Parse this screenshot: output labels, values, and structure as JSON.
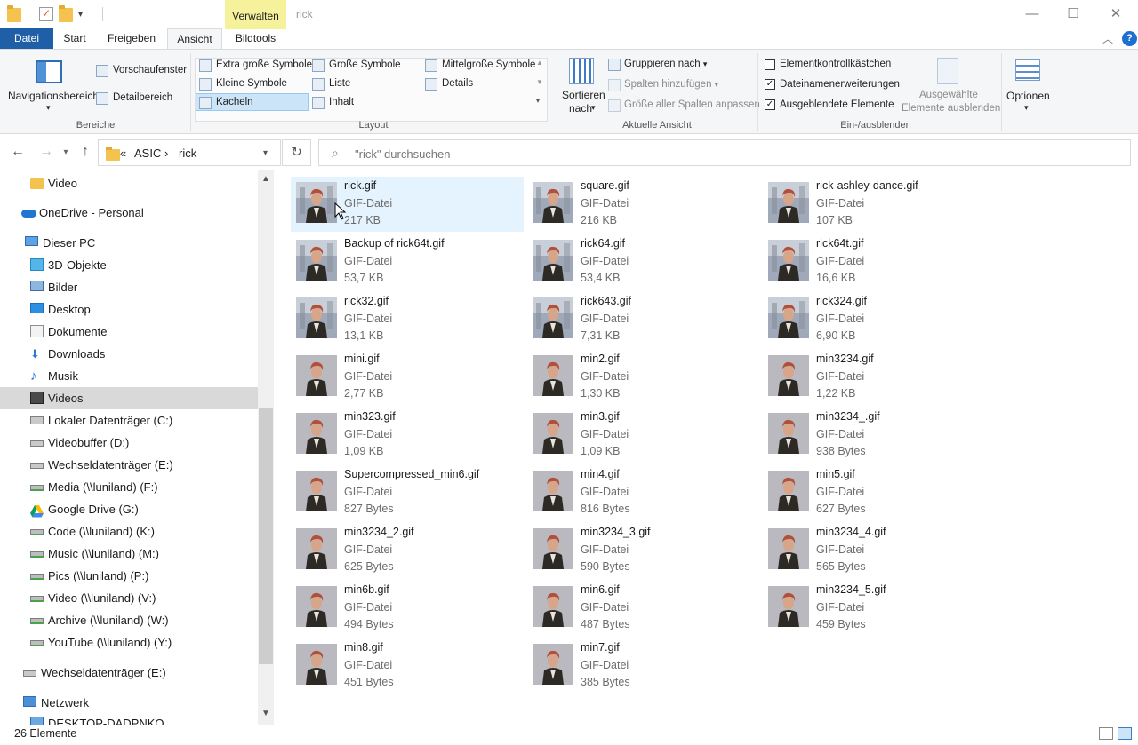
{
  "window": {
    "title": "rick",
    "contextual_tab": "Verwalten",
    "controls": {
      "minimize": "—",
      "maximize": "☐",
      "close": "✕"
    }
  },
  "tabs": {
    "file": "Datei",
    "start": "Start",
    "share": "Freigeben",
    "view": "Ansicht",
    "picture_tools": "Bildtools"
  },
  "ribbon": {
    "panes": {
      "navigation_pane": "Navigationsbereich",
      "preview_pane": "Vorschaufenster",
      "details_pane": "Detailbereich",
      "group_label": "Bereiche"
    },
    "layout": {
      "extra_large": "Extra große Symbole",
      "large": "Große Symbole",
      "medium": "Mittelgroße Symbole",
      "small": "Kleine Symbole",
      "list": "Liste",
      "details": "Details",
      "tiles": "Kacheln",
      "content": "Inhalt",
      "group_label": "Layout",
      "selected": "Kacheln"
    },
    "current_view": {
      "sort_by_line1": "Sortieren",
      "sort_by_line2": "nach",
      "group_by": "Gruppieren nach",
      "add_columns": "Spalten hinzufügen",
      "size_columns": "Größe aller Spalten anpassen",
      "group_label": "Aktuelle Ansicht"
    },
    "show_hide": {
      "item_checkboxes": "Elementkontrollkästchen",
      "item_checkboxes_checked": false,
      "file_extensions": "Dateinamenerweiterungen",
      "file_extensions_checked": true,
      "hidden_items": "Ausgeblendete Elemente",
      "hidden_items_checked": true,
      "hide_selected_line1": "Ausgewählte",
      "hide_selected_line2": "Elemente ausblenden",
      "group_label": "Ein-/ausblenden"
    },
    "options": "Optionen"
  },
  "address": {
    "crumbs": [
      "«",
      "ASIC",
      "›",
      "rick"
    ],
    "search_placeholder": "\"rick\" durchsuchen"
  },
  "sidebar": {
    "items": [
      {
        "label": "Video",
        "icon": "folder-icon"
      },
      {
        "label": "OneDrive - Personal",
        "icon": "onedrive-icon"
      },
      {
        "label": "Dieser PC",
        "icon": "this-pc-icon"
      },
      {
        "label": "3D-Objekte",
        "icon": "3d-objects-icon"
      },
      {
        "label": "Bilder",
        "icon": "pictures-icon"
      },
      {
        "label": "Desktop",
        "icon": "desktop-icon"
      },
      {
        "label": "Dokumente",
        "icon": "documents-icon"
      },
      {
        "label": "Downloads",
        "icon": "downloads-icon"
      },
      {
        "label": "Musik",
        "icon": "music-icon"
      },
      {
        "label": "Videos",
        "icon": "videos-icon",
        "selected": true
      },
      {
        "label": "Lokaler Datenträger (C:)",
        "icon": "local-disk-icon"
      },
      {
        "label": "Videobuffer (D:)",
        "icon": "drive-icon"
      },
      {
        "label": "Wechseldatenträger (E:)",
        "icon": "removable-drive-icon"
      },
      {
        "label": "Media (\\\\luniland) (F:)",
        "icon": "network-drive-icon"
      },
      {
        "label": "Google Drive (G:)",
        "icon": "google-drive-icon"
      },
      {
        "label": "Code (\\\\luniland) (K:)",
        "icon": "network-drive-icon"
      },
      {
        "label": "Music (\\\\luniland) (M:)",
        "icon": "network-drive-icon"
      },
      {
        "label": "Pics (\\\\luniland) (P:)",
        "icon": "network-drive-icon"
      },
      {
        "label": "Video (\\\\luniland) (V:)",
        "icon": "network-drive-icon"
      },
      {
        "label": "Archive (\\\\luniland) (W:)",
        "icon": "network-drive-icon"
      },
      {
        "label": "YouTube (\\\\luniland) (Y:)",
        "icon": "network-drive-icon"
      },
      {
        "label": "Wechseldatenträger (E:)",
        "icon": "removable-drive-icon"
      },
      {
        "label": "Netzwerk",
        "icon": "network-icon"
      },
      {
        "label": "DESKTOP-DADPNKO",
        "icon": "computer-icon"
      }
    ]
  },
  "files": [
    {
      "name": "rick.gif",
      "type": "GIF-Datei",
      "size": "217 KB",
      "selected": true
    },
    {
      "name": "square.gif",
      "type": "GIF-Datei",
      "size": "216 KB"
    },
    {
      "name": "rick-ashley-dance.gif",
      "type": "GIF-Datei",
      "size": "107 KB"
    },
    {
      "name": "Backup of rick64t.gif",
      "type": "GIF-Datei",
      "size": "53,7 KB"
    },
    {
      "name": "rick64.gif",
      "type": "GIF-Datei",
      "size": "53,4 KB"
    },
    {
      "name": "rick64t.gif",
      "type": "GIF-Datei",
      "size": "16,6 KB"
    },
    {
      "name": "rick32.gif",
      "type": "GIF-Datei",
      "size": "13,1 KB"
    },
    {
      "name": "rick643.gif",
      "type": "GIF-Datei",
      "size": "7,31 KB"
    },
    {
      "name": "rick324.gif",
      "type": "GIF-Datei",
      "size": "6,90 KB"
    },
    {
      "name": "mini.gif",
      "type": "GIF-Datei",
      "size": "2,77 KB"
    },
    {
      "name": "min2.gif",
      "type": "GIF-Datei",
      "size": "1,30 KB"
    },
    {
      "name": "min3234.gif",
      "type": "GIF-Datei",
      "size": "1,22 KB"
    },
    {
      "name": "min323.gif",
      "type": "GIF-Datei",
      "size": "1,09 KB"
    },
    {
      "name": "min3.gif",
      "type": "GIF-Datei",
      "size": "1,09 KB"
    },
    {
      "name": "min3234_.gif",
      "type": "GIF-Datei",
      "size": "938 Bytes"
    },
    {
      "name": "Supercompressed_min6.gif",
      "type": "GIF-Datei",
      "size": "827 Bytes"
    },
    {
      "name": "min4.gif",
      "type": "GIF-Datei",
      "size": "816 Bytes"
    },
    {
      "name": "min5.gif",
      "type": "GIF-Datei",
      "size": "627 Bytes"
    },
    {
      "name": "min3234_2.gif",
      "type": "GIF-Datei",
      "size": "625 Bytes"
    },
    {
      "name": "min3234_3.gif",
      "type": "GIF-Datei",
      "size": "590 Bytes"
    },
    {
      "name": "min3234_4.gif",
      "type": "GIF-Datei",
      "size": "565 Bytes"
    },
    {
      "name": "min6b.gif",
      "type": "GIF-Datei",
      "size": "494 Bytes"
    },
    {
      "name": "min6.gif",
      "type": "GIF-Datei",
      "size": "487 Bytes"
    },
    {
      "name": "min3234_5.gif",
      "type": "GIF-Datei",
      "size": "459 Bytes"
    },
    {
      "name": "min8.gif",
      "type": "GIF-Datei",
      "size": "451 Bytes"
    },
    {
      "name": "min7.gif",
      "type": "GIF-Datei",
      "size": "385 Bytes"
    }
  ],
  "status": {
    "count": "26 Elemente"
  },
  "colors": {
    "file_tab": "#1f5fa8",
    "contextual_tab": "#f6f29b",
    "selection": "#e5f3ff",
    "sidebar_selected": "#d9d9d9"
  }
}
